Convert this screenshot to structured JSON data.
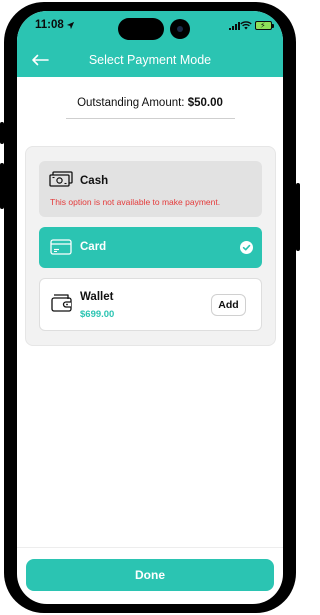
{
  "status_bar": {
    "time": "11:08"
  },
  "header": {
    "title": "Select Payment Mode"
  },
  "outstanding": {
    "label": "Outstanding Amount:",
    "amount": "$50.00"
  },
  "options": {
    "cash": {
      "label": "Cash",
      "note": "This option is not available to make payment."
    },
    "card": {
      "label": "Card",
      "selected": true
    },
    "wallet": {
      "label": "Wallet",
      "balance": "$699.00",
      "add_label": "Add"
    }
  },
  "footer": {
    "done_label": "Done"
  },
  "colors": {
    "accent": "#2bc4b2",
    "error": "#e43b3b",
    "disabled_bg": "#e2e2e2"
  }
}
